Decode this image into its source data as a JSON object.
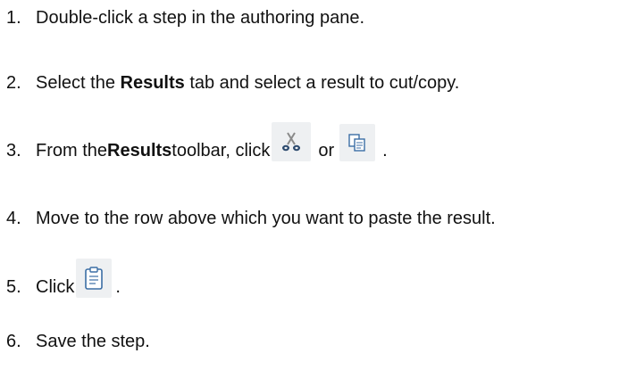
{
  "steps": [
    {
      "num": "1.",
      "text": "Double-click a step in the authoring pane."
    },
    {
      "num": "2.",
      "pre": "Select the ",
      "bold": "Results",
      "post": " tab and select a result to cut/copy."
    },
    {
      "num": "3.",
      "pre": "From the ",
      "bold": "Results",
      "mid": " toolbar, click ",
      "or": " or ",
      "end": "."
    },
    {
      "num": "4.",
      "text": "Move to the row above which you want to paste the result."
    },
    {
      "num": "5.",
      "pre": "Click ",
      "end": "."
    },
    {
      "num": "6.",
      "text": "Save the step."
    }
  ],
  "icons": {
    "cut": "scissors-icon",
    "copy": "copy-icon",
    "paste": "clipboard-icon"
  }
}
